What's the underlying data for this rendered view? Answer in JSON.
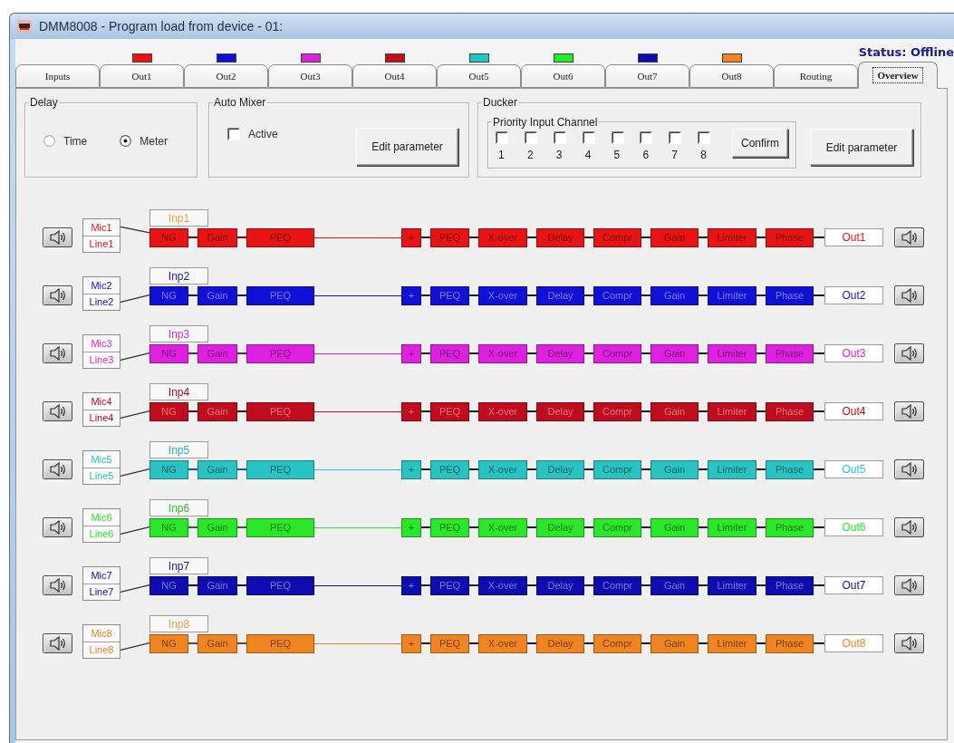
{
  "window": {
    "title": "DMM8008 - Program load from device - 01:"
  },
  "status": "Status: Offline",
  "tabs": [
    {
      "label": "Inputs",
      "selected": false
    },
    {
      "label": "Out1",
      "selected": false,
      "color": "#e81414"
    },
    {
      "label": "Out2",
      "selected": false,
      "color": "#1010d8"
    },
    {
      "label": "Out3",
      "selected": false,
      "color": "#e020e0"
    },
    {
      "label": "Out4",
      "selected": false,
      "color": "#c00c1c"
    },
    {
      "label": "Out5",
      "selected": false,
      "color": "#28c4c4"
    },
    {
      "label": "Out6",
      "selected": false,
      "color": "#28e828"
    },
    {
      "label": "Out7",
      "selected": false,
      "color": "#0c0cb0"
    },
    {
      "label": "Out8",
      "selected": false,
      "color": "#f08420"
    },
    {
      "label": "Routing",
      "selected": false
    },
    {
      "label": "Overview",
      "selected": true
    }
  ],
  "delay": {
    "title": "Delay",
    "options": [
      {
        "label": "Time",
        "selected": false
      },
      {
        "label": "Meter",
        "selected": true
      }
    ]
  },
  "auto_mixer": {
    "title": "Auto Mixer",
    "active": {
      "label": "Active",
      "checked": false
    },
    "button": "Edit parameter"
  },
  "ducker": {
    "title": "Ducker",
    "priority": {
      "title": "Priority Input Channel",
      "channels": [
        {
          "label": "1",
          "checked": false
        },
        {
          "label": "2",
          "checked": false
        },
        {
          "label": "3",
          "checked": false
        },
        {
          "label": "4",
          "checked": false
        },
        {
          "label": "5",
          "checked": false
        },
        {
          "label": "6",
          "checked": false
        },
        {
          "label": "7",
          "checked": false
        },
        {
          "label": "8",
          "checked": false
        }
      ],
      "button": "Confirm"
    },
    "button": "Edit parameter"
  },
  "channels": [
    {
      "color": "#e81414",
      "input": {
        "label": "Inp1",
        "color": "#e8a838"
      },
      "sources": [
        {
          "label": "Mic1",
          "selected": true
        },
        {
          "label": "Line1",
          "selected": false
        }
      ],
      "pre": [
        "NG",
        "Gain",
        "PEQ"
      ],
      "post": [
        "+",
        "PEQ",
        "X-over",
        "Delay",
        "Compr",
        "Gain",
        "Limiter",
        "Phase"
      ],
      "output": "Out1"
    },
    {
      "color": "#1010d8",
      "input": {
        "label": "Inp2",
        "color": "#1c1c9c"
      },
      "sources": [
        {
          "label": "Mic2",
          "selected": false
        },
        {
          "label": "Line2",
          "selected": true
        }
      ],
      "pre": [
        "NG",
        "Gain",
        "PEQ"
      ],
      "post": [
        "+",
        "PEQ",
        "X-over",
        "Delay",
        "Compr",
        "Gain",
        "Limiter",
        "Phase"
      ],
      "output": "Out2"
    },
    {
      "color": "#e020e0",
      "input": {
        "label": "Inp3",
        "color": "#d030d0"
      },
      "sources": [
        {
          "label": "Mic3",
          "selected": false
        },
        {
          "label": "Line3",
          "selected": true
        }
      ],
      "pre": [
        "NG",
        "Gain",
        "PEQ"
      ],
      "post": [
        "+",
        "PEQ",
        "X-over",
        "Delay",
        "Compr",
        "Gain",
        "Limiter",
        "Phase"
      ],
      "output": "Out3"
    },
    {
      "color": "#c00c1c",
      "input": {
        "label": "Inp4",
        "color": "#a01020"
      },
      "sources": [
        {
          "label": "Mic4",
          "selected": false
        },
        {
          "label": "Line4",
          "selected": true
        }
      ],
      "pre": [
        "NG",
        "Gain",
        "PEQ"
      ],
      "post": [
        "+",
        "PEQ",
        "X-over",
        "Delay",
        "Compr",
        "Gain",
        "Limiter",
        "Phase"
      ],
      "output": "Out4"
    },
    {
      "color": "#28c4c4",
      "input": {
        "label": "Inp5",
        "color": "#30b0b0"
      },
      "sources": [
        {
          "label": "Mic5",
          "selected": false
        },
        {
          "label": "Line5",
          "selected": true
        }
      ],
      "pre": [
        "NG",
        "Gain",
        "PEQ"
      ],
      "post": [
        "+",
        "PEQ",
        "X-over",
        "Delay",
        "Compr",
        "Gain",
        "Limiter",
        "Phase"
      ],
      "output": "Out5"
    },
    {
      "color": "#28e828",
      "input": {
        "label": "Inp6",
        "color": "#30c030"
      },
      "sources": [
        {
          "label": "Mic6",
          "selected": false
        },
        {
          "label": "Line6",
          "selected": true
        }
      ],
      "pre": [
        "NG",
        "Gain",
        "PEQ"
      ],
      "post": [
        "+",
        "PEQ",
        "X-over",
        "Delay",
        "Compr",
        "Gain",
        "Limiter",
        "Phase"
      ],
      "output": "Out6"
    },
    {
      "color": "#0c0cb0",
      "input": {
        "label": "Inp7",
        "color": "#1c1c8c"
      },
      "sources": [
        {
          "label": "Mic7",
          "selected": false
        },
        {
          "label": "Line7",
          "selected": true
        }
      ],
      "pre": [
        "NG",
        "Gain",
        "PEQ"
      ],
      "post": [
        "+",
        "PEQ",
        "X-over",
        "Delay",
        "Compr",
        "Gain",
        "Limiter",
        "Phase"
      ],
      "output": "Out7"
    },
    {
      "color": "#f08420",
      "input": {
        "label": "Inp8",
        "color": "#e8a040"
      },
      "sources": [
        {
          "label": "Mic8",
          "selected": false
        },
        {
          "label": "Line8",
          "selected": true
        }
      ],
      "pre": [
        "NG",
        "Gain",
        "PEQ"
      ],
      "post": [
        "+",
        "PEQ",
        "X-over",
        "Delay",
        "Compr",
        "Gain",
        "Limiter",
        "Phase"
      ],
      "output": "Out8"
    }
  ]
}
